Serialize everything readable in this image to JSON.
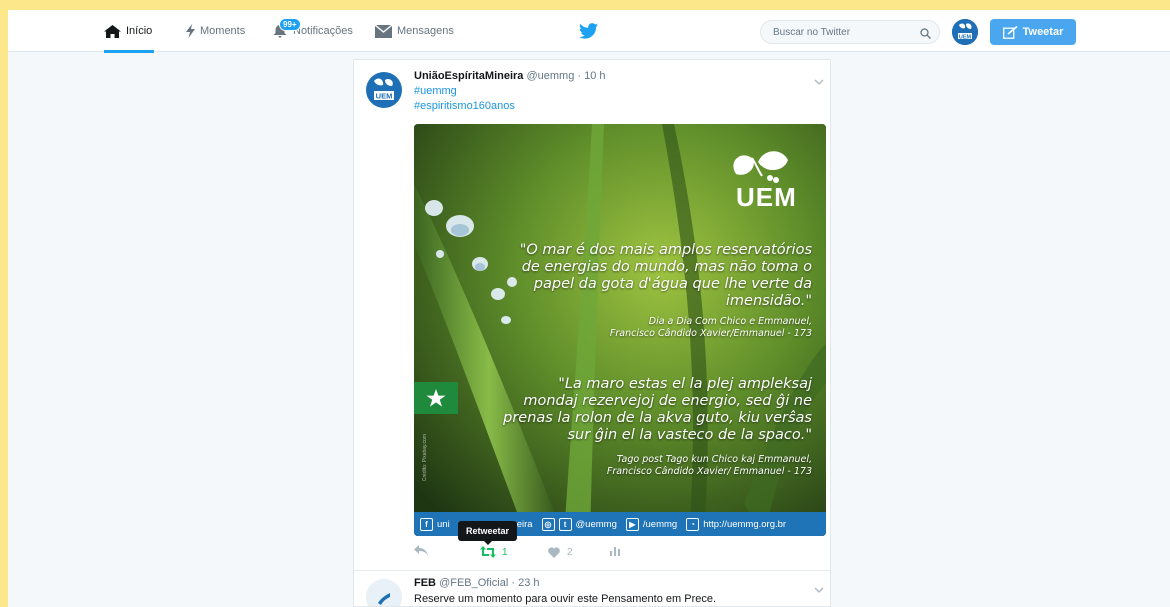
{
  "nav": {
    "home_label": "Início",
    "moments_label": "Moments",
    "notifications_label": "Notificações",
    "notifications_badge": "99+",
    "messages_label": "Mensagens"
  },
  "search": {
    "placeholder": "Buscar no Twitter"
  },
  "tweet_button_label": "Tweetar",
  "colors": {
    "accent": "#1da1f2",
    "retweet": "#17bf63",
    "page_border": "#fce88a"
  },
  "tweets": [
    {
      "name": "UniãoEspíritaMineira",
      "handle": "@uemmg",
      "time": "· 10 h",
      "hashtags": [
        "#uemmg",
        "#espiritismo160anos"
      ],
      "media": {
        "logo_text": "UEM",
        "quote_pt": "\"O mar  é dos mais amplos reservatórios de energias do mundo, mas não toma o papel da gota d'água que lhe verte da imensidão.\"",
        "source_pt_1": "Dia a Dia Com Chico e Emmanuel,",
        "source_pt_2": "Francisco Cândido Xavier/Emmanuel - 173",
        "quote_eo": "\"La maro estas el la plej ampleksaj mondaj rezervejoj de energio, sed ĝi ne prenas la rolon de la akva guto, kiu verŝas sur ĝin el la vasteco de la spaco.\"",
        "source_eo_1": "Tago post Tago kun Chico kaj Emmanuel,",
        "source_eo_2": "Francisco Cândido Xavier/ Emmanuel - 173",
        "photo_credit": "Crédito: Pixabay.com",
        "footer": {
          "facebook": "uni",
          "facebook_tail": "eira",
          "instagram_twitter": "@uemmg",
          "youtube": "/uemmg",
          "site": "http://uemmg.org.br"
        }
      },
      "tooltip": "Retweetar",
      "retweets": "1",
      "likes": "2"
    },
    {
      "name": "FEB",
      "handle": "@FEB_Oficial",
      "time": "· 23 h",
      "text": "Reserve um momento para ouvir este Pensamento em Prece."
    }
  ]
}
